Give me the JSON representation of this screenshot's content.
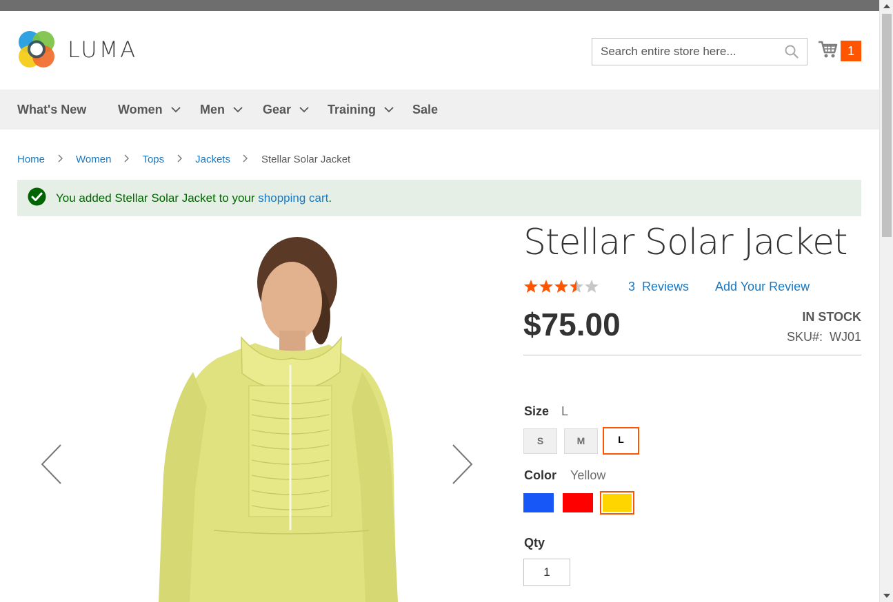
{
  "header": {
    "logo_text": "LUMA",
    "search_placeholder": "Search entire store here...",
    "cart_count": "1"
  },
  "nav": {
    "items": [
      {
        "label": "What's New",
        "has_dropdown": false
      },
      {
        "label": "Women",
        "has_dropdown": true
      },
      {
        "label": "Men",
        "has_dropdown": true
      },
      {
        "label": "Gear",
        "has_dropdown": true
      },
      {
        "label": "Training",
        "has_dropdown": true
      },
      {
        "label": "Sale",
        "has_dropdown": false
      }
    ]
  },
  "breadcrumb": {
    "items": [
      "Home",
      "Women",
      "Tops",
      "Jackets"
    ],
    "current": "Stellar Solar Jacket"
  },
  "message": {
    "text_before": "You added Stellar Solar Jacket to your ",
    "link": "shopping cart",
    "text_after": "."
  },
  "product": {
    "name": "Stellar Solar Jacket",
    "rating_stars": 3.5,
    "rating_max": 5,
    "reviews_count": "3",
    "reviews_label": "Reviews",
    "add_review": "Add Your Review",
    "price": "$75.00",
    "stock": "IN STOCK",
    "sku_label": "SKU#:",
    "sku": "WJ01",
    "size": {
      "label": "Size",
      "selected": "L",
      "options": [
        "S",
        "M",
        "L"
      ]
    },
    "color": {
      "label": "Color",
      "selected": "Yellow",
      "options": [
        {
          "name": "Blue",
          "hex": "#1857f7"
        },
        {
          "name": "Red",
          "hex": "#ff0000"
        },
        {
          "name": "Yellow",
          "hex": "#ffd500"
        }
      ]
    },
    "qty": {
      "label": "Qty",
      "value": "1"
    }
  },
  "colors": {
    "accent": "#ff5501",
    "link": "#1979c3",
    "success_bg": "#e5efe5",
    "success_text": "#006400",
    "star_filled": "#ff5501",
    "star_empty": "#c7c7c7"
  }
}
